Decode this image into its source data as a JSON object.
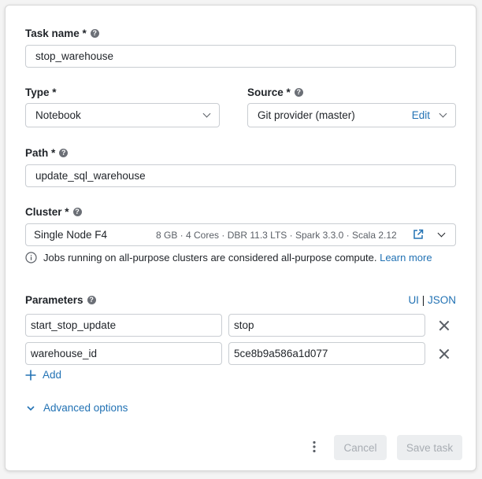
{
  "task_name": {
    "label": "Task name *",
    "value": "stop_warehouse"
  },
  "type": {
    "label": "Type *",
    "value": "Notebook"
  },
  "source": {
    "label": "Source *",
    "value": "Git provider (master)",
    "edit_label": "Edit"
  },
  "path": {
    "label": "Path *",
    "value": "update_sql_warehouse"
  },
  "cluster": {
    "label": "Cluster *",
    "name": "Single Node F4",
    "details": "8 GB · 4 Cores · DBR 11.3 LTS · Spark 3.3.0 · Scala 2.12",
    "info_text": "Jobs running on all-purpose clusters are considered all-purpose compute.",
    "learn_more": "Learn more"
  },
  "parameters": {
    "label": "Parameters",
    "mode_ui": "UI",
    "mode_sep": "|",
    "mode_json": "JSON",
    "rows": [
      {
        "key": "start_stop_update",
        "value": "stop"
      },
      {
        "key": "warehouse_id",
        "value": "5ce8b9a586a1d077"
      }
    ],
    "add_label": "Add"
  },
  "advanced_options": "Advanced options",
  "footer": {
    "cancel": "Cancel",
    "save": "Save task"
  },
  "colors": {
    "link": "#2272b4",
    "border": "#c9cdd2",
    "disabled_bg": "#eceef0"
  }
}
